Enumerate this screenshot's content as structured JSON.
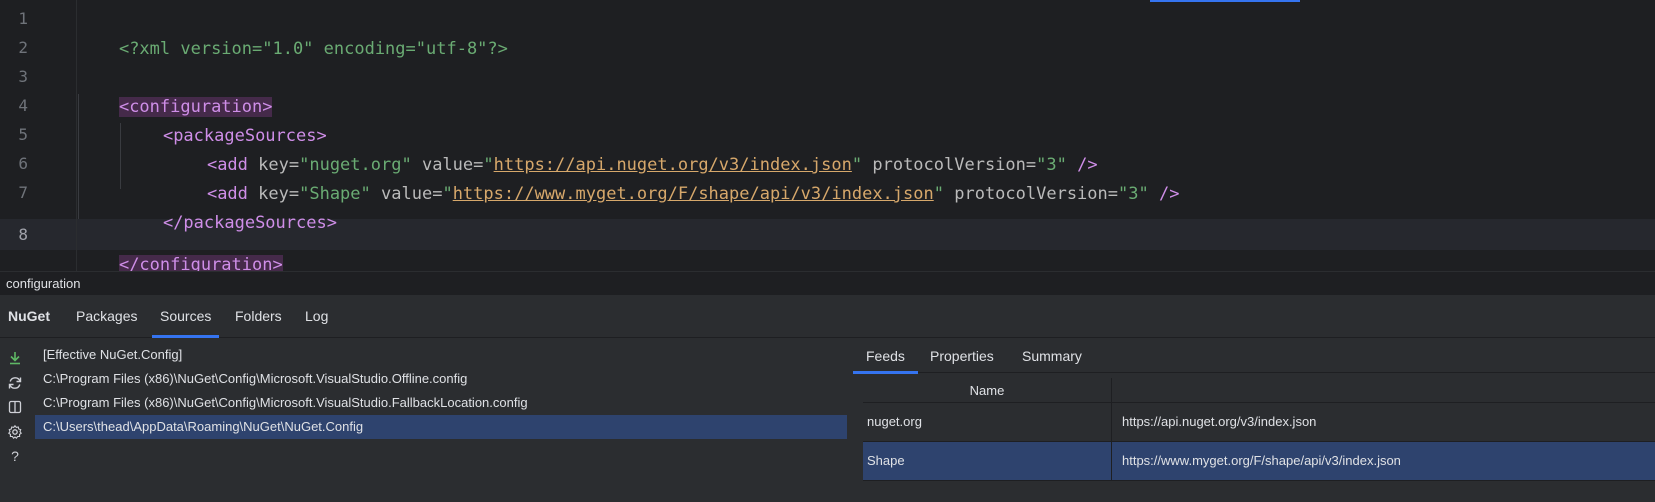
{
  "editor": {
    "line_numbers": [
      "1",
      "2",
      "3",
      "4",
      "5",
      "6",
      "7",
      "8"
    ],
    "line1": {
      "pi": "<?xml version=\"1.0\" encoding=\"utf-8\"?>"
    },
    "line3": {
      "open": "<configuration>"
    },
    "line4": {
      "open": "<packageSources>"
    },
    "line5": {
      "tag": "<add",
      "key_attr": "key=",
      "key_val": "\"nuget.org\"",
      "value_attr": "value=",
      "q1": "\"",
      "url": "https://api.nuget.org/v3/index.json",
      "q2": "\"",
      "pv_attr": "protocolVersion=",
      "pv_val": "\"3\"",
      "close": "/>"
    },
    "line6": {
      "tag": "<add",
      "key_attr": "key=",
      "key_val": "\"Shape\"",
      "value_attr": "value=",
      "q1": "\"",
      "url": "https://www.myget.org/F/shape/api/v3/index.json",
      "q2": "\"",
      "pv_attr": "protocolVersion=",
      "pv_val": "\"3\"",
      "close": "/>"
    },
    "line7": {
      "close": "</packageSources>"
    },
    "line8": {
      "close": "</configuration>"
    }
  },
  "breadcrumb": {
    "text": "configuration"
  },
  "tool_window": {
    "title": "NuGet",
    "tabs": [
      "Packages",
      "Sources",
      "Folders",
      "Log"
    ],
    "selected_tab": "Sources"
  },
  "toolbar": {
    "icons": [
      "download-icon",
      "refresh-icon",
      "book-icon",
      "gear-icon",
      "help-icon"
    ],
    "help_glyph": "?"
  },
  "sources": [
    "[Effective NuGet.Config]",
    "C:\\Program Files (x86)\\NuGet\\Config\\Microsoft.VisualStudio.Offline.config",
    "C:\\Program Files (x86)\\NuGet\\Config\\Microsoft.VisualStudio.FallbackLocation.config",
    "C:\\Users\\thead\\AppData\\Roaming\\NuGet\\NuGet.Config"
  ],
  "selected_source_index": 3,
  "details": {
    "tabs": [
      "Feeds",
      "Properties",
      "Summary"
    ],
    "selected_tab": "Feeds",
    "table": {
      "header_name": "Name",
      "rows": [
        {
          "name": "nuget.org",
          "url": "https://api.nuget.org/v3/index.json"
        },
        {
          "name": "Shape",
          "url": "https://www.myget.org/F/shape/api/v3/index.json"
        }
      ],
      "selected_row_index": 1
    }
  },
  "colors": {
    "accent": "#3574f0",
    "selection": "#2e436e",
    "tag_highlight": "#452a4a"
  }
}
